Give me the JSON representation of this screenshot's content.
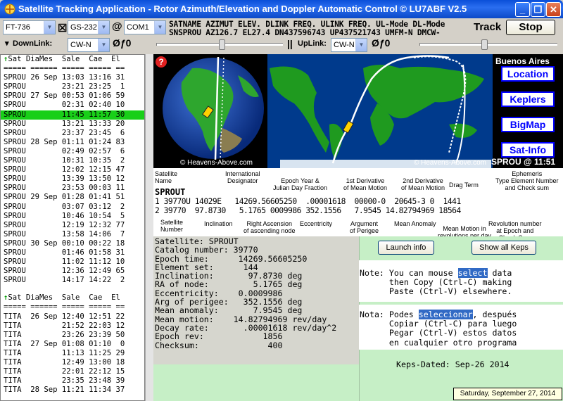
{
  "window": {
    "title": "Satellite Tracking Application - Rotor Azimuth/Elevation and Doppler Automatic Control  © LU7ABF   V2.5",
    "min_label": "_",
    "max_label": "❐",
    "close_label": "✕"
  },
  "toolbar": {
    "radio": "FT-736",
    "rotor": "GS-232",
    "at": "@",
    "port": "COM1",
    "header_line": "SATNAME AZIMUT ELEV. DLINK FREQ. ULINK FREQ. UL-Mode DL-Mode",
    "data_line": "SNSPROU AZ126.7 EL27.4 DN437596743 UP437521743 UMFM-N DMCW-",
    "track_label": "Track",
    "stop_label": "Stop",
    "downlink_label": "DownLink:",
    "downlink_mode": "CW-N",
    "downlink_offset": "Øƒ0",
    "separator": "||",
    "uplink_label": "UpLink:",
    "uplink_mode": "CW-N",
    "uplink_offset": "Øƒ0",
    "dropdown_arrow": "▼"
  },
  "pass_list_1": {
    "header": "Sat DiaMes  Sale  Cae  El",
    "rule": "===== ====== ===== ===== ==",
    "rows": [
      "SPROU 26 Sep 13:03 13:16 31",
      "SPROU        23:21 23:25  1",
      "SPROU 27 Sep 00:53 01:06 59",
      "SPROU        02:31 02:40 10",
      "SPROU        11:45 11:57 30",
      "SPROU        13:21 13:33 20",
      "SPROU        23:37 23:45  6",
      "SPROU 28 Sep 01:11 01:24 83",
      "SPROU        02:49 02:57  6",
      "SPROU        10:31 10:35  2",
      "SPROU        12:02 12:15 47",
      "SPROU        13:39 13:50 12",
      "SPROU        23:53 00:03 11",
      "SPROU 29 Sep 01:28 01:41 51",
      "SPROU        03:07 03:12  2",
      "SPROU        10:46 10:54  5",
      "SPROU        12:19 12:32 77",
      "SPROU        13:58 14:06  7",
      "SPROU 30 Sep 00:10 00:22 18",
      "SPROU        01:46 01:58 31",
      "SPROU        11:02 11:12 10",
      "SPROU        12:36 12:49 65",
      "SPROU        14:17 14:22  2"
    ],
    "highlight_index": 4
  },
  "pass_list_2": {
    "header": "Sat DiaMes  Sale  Cae  El",
    "rule": "===== ====== ===== ===== ==",
    "rows": [
      "TITA  26 Sep 12:40 12:51 22",
      "TITA         21:52 22:03 12",
      "TITA         23:26 23:39 50",
      "TITA  27 Sep 01:08 01:10  0",
      "TITA         11:13 11:25 29",
      "TITA         12:49 13:00 18",
      "TITA         22:01 22:12 15",
      "TITA         23:35 23:48 39",
      "TITA  28 Sep 11:21 11:34 37"
    ]
  },
  "map_panel": {
    "help": "?",
    "location_name": "Buenos Aires",
    "buttons": [
      "Location",
      "Keplers",
      "BigMap",
      "Sat-Info"
    ],
    "credit_globe": "© Heavens-Above.com",
    "credit_map": "© Heavens-Above.com",
    "sat_time": "SPROU @ 11:51"
  },
  "tle": {
    "labels": {
      "sat_name": "Satellite\nName",
      "intl": "International\nDesignator",
      "epoch": "Epoch Year &\nJulian Day Fraction",
      "d1": "1st Derivative\nof Mean Motion",
      "d2": "2nd Derivative\nof Mean Motion",
      "drag": "Drag Term",
      "eph": "Ephemeris\nType Element Number\nand Check sum",
      "satnum": "Satellite\nNumber",
      "incl": "Inclination",
      "raan": "Right Ascension\nof ascending node",
      "ecc": "Eccentricity",
      "argp": "Argument\nof Perigee",
      "ma": "Mean Anomaly",
      "mm": "Mean Motion in\nrevolutions per day",
      "rev": "Revolution number\nat Epoch and\nCheck Sum"
    },
    "name": "SPROUT",
    "line1": "1 39770U 14029E   14269.56605250  .00001618  00000-0  20645-3 0  1441",
    "line2": "2 39770  97.8730   5.1765 0009986 352.1556   7.9545 14.82794969 18564"
  },
  "satinfo": {
    "lines": [
      "Satellite: SPROUT",
      "Catalog number: 39770",
      "Epoch time:      14269.56605250",
      "Element set:      144",
      "Inclination:       97.8730 deg",
      "RA of node:         5.1765 deg",
      "Eccentricity:    0.0009986",
      "Arg of perigee:   352.1556 deg",
      "Mean anomaly:       7.9545 deg",
      "Mean motion:    14.82794969 rev/day",
      "Decay rate:       .00001618 rev/day^2",
      "Epoch rev:            1856",
      "Checksum:              400"
    ]
  },
  "actions": {
    "launch_info": "Launch info",
    "show_keps": "Show all Keps"
  },
  "notes": {
    "en_pre": "Note: You can mouse ",
    "en_sel": "select",
    "en_post": " data",
    "en_l2": "      then Copy (Ctrl-C) making",
    "en_l3": "      Paste (Ctrl-V) elsewhere.",
    "es_pre": "Nota: Podes ",
    "es_sel": "seleccionar",
    "es_post": ", después",
    "es_l2": "      Copiar (Ctrl-C) para luego",
    "es_l3": "      Pegar (Ctrl-V) estos datos",
    "es_l4": "      en cualquier otro programa",
    "keps_dated": "Keps-Dated: Sep-26 2014"
  },
  "status": {
    "date": "Saturday, September 27, 2014"
  },
  "colors": {
    "highlight_row": "#18cf18",
    "map_ocean": "#003a8c",
    "map_land": "#1f9a1f",
    "panel_bg": "#c6efc6",
    "button_blue": "#0000ff"
  }
}
